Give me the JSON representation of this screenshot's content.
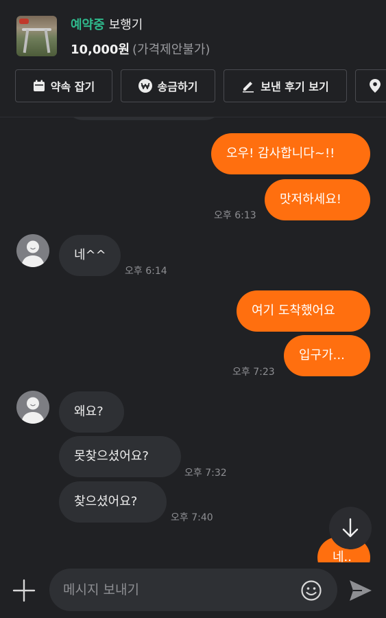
{
  "item": {
    "status": "예약중",
    "title": "보행기",
    "price": "10,000원",
    "price_note": "(가격제안불가)"
  },
  "actions": [
    {
      "label": "약속 잡기",
      "icon": "calendar-icon"
    },
    {
      "label": "송금하기",
      "icon": "won-icon"
    },
    {
      "label": "보낸 후기 보기",
      "icon": "pencil-icon"
    },
    {
      "label": "",
      "icon": "location-pin-icon"
    }
  ],
  "messages": [
    {
      "from": "me",
      "text": "오우! 감사합니다~!!",
      "time": ""
    },
    {
      "from": "me",
      "text": "맛저하세요!",
      "time": "오후 6:13"
    },
    {
      "from": "other",
      "text": "네^^",
      "time": "오후 6:14"
    },
    {
      "from": "me",
      "text": "여기 도착했어요",
      "time": ""
    },
    {
      "from": "me",
      "text": "입구가...",
      "time": "오후 7:23"
    },
    {
      "from": "other",
      "text": "왜요?",
      "time": ""
    },
    {
      "from": "other",
      "text": "못찾으셨어요?",
      "time": "오후 7:32"
    },
    {
      "from": "other",
      "text": "찾으셨어요?",
      "time": "오후 7:40"
    },
    {
      "from": "me",
      "text": "네..",
      "time": ""
    }
  ],
  "composer": {
    "placeholder": "메시지 보내기"
  },
  "colors": {
    "accent": "#ff6f0f",
    "status_green": "#2fb98c",
    "background": "#202124",
    "bubble_other": "#2e3034"
  }
}
